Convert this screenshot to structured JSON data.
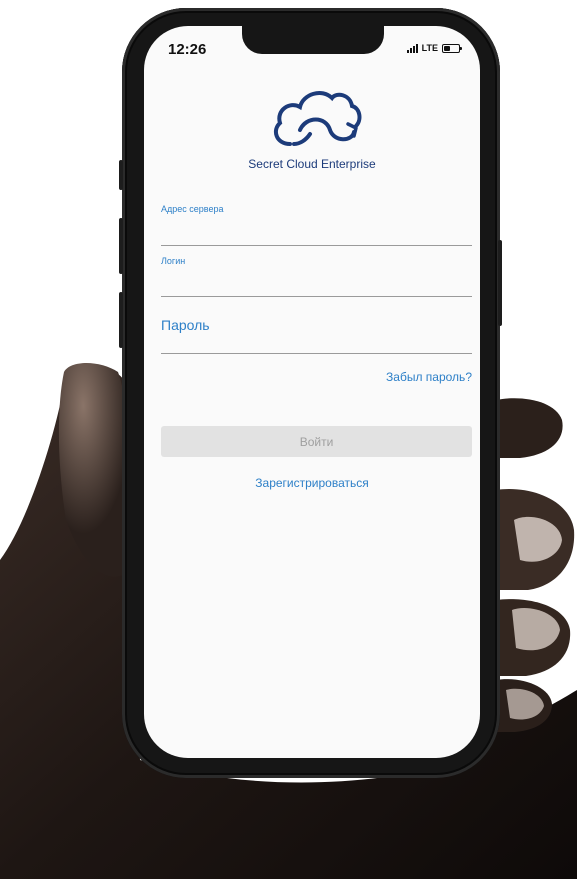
{
  "status_bar": {
    "time": "12:26",
    "network": "LTE",
    "battery_level": 0.45
  },
  "app": {
    "brand": "Secret Cloud Enterprise",
    "logo_icon": "cloud-sync-icon",
    "accent_color": "#2e80c8",
    "brand_color": "#1c3b7a"
  },
  "form": {
    "server_label": "Адрес сервера",
    "login_label": "Логин",
    "password_placeholder": "Пароль",
    "forgot_password": "Забыл пароль?",
    "submit_label": "Войти",
    "register_label": "Зарегистрироваться"
  }
}
